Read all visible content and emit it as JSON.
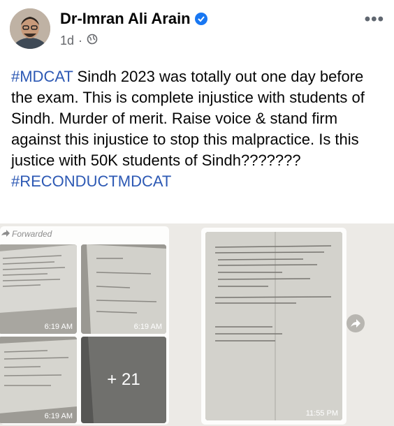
{
  "post": {
    "author": "Dr-Imran Ali Arain",
    "time": "1d",
    "separator": "·",
    "more_label": "•••",
    "text_tag1": "#MDCAT",
    "text_body": " Sindh 2023 was totally out one day before the exam. This is complete injustice with students of Sindh. Murder of merit. Raise voice & stand firm against this injustice to stop this malpractice. Is this justice with 50K students of Sindh???????",
    "text_tag2": "#RECONDUCTMDCAT"
  },
  "attachment": {
    "forwarded_label": "Forwarded",
    "thumb_times": [
      "6:19 AM",
      "6:19 AM",
      "6:19 AM"
    ],
    "more_count": "+ 21",
    "single_time": "11:55 PM"
  },
  "colors": {
    "hashtag": "#2d59b4",
    "verified": "#1877f2"
  },
  "icons": {
    "verified": "verified-badge-icon",
    "privacy": "globe-icon",
    "more": "more-options-icon",
    "forward": "forward-icon",
    "share": "share-icon"
  }
}
